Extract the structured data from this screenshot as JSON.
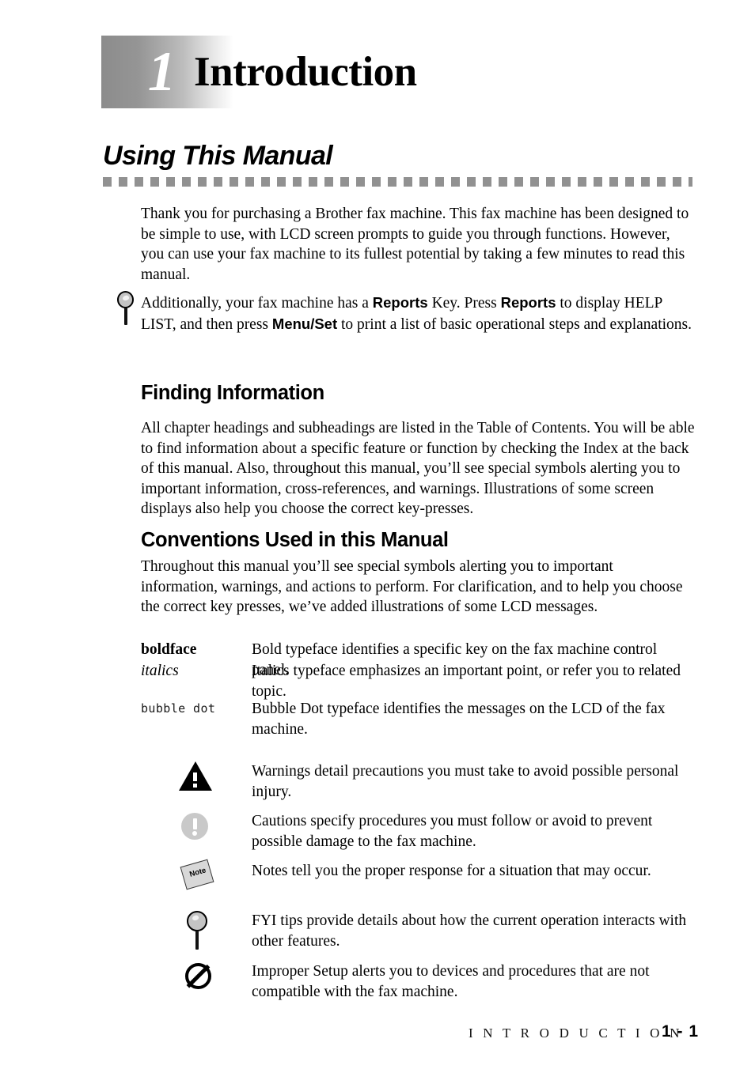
{
  "chapter": {
    "number": "1",
    "title": "Introduction"
  },
  "section": {
    "title": "Using This Manual"
  },
  "intro_paragraph": "Thank you for purchasing a Brother fax machine. This fax machine has been designed to be simple to use, with LCD screen prompts to guide you through functions. However, you can use your fax machine to its fullest potential by taking a few minutes to read this manual.",
  "fyi_note": {
    "icon": "magnifier-fyi-icon",
    "text_part_1": "Additionally, your fax machine has a ",
    "key_1": "Reports",
    "text_part_2": " Key. Press ",
    "key_2": "Reports",
    "text_part_3": " to display HELP LIST, and then press ",
    "key_3": "Menu/Set",
    "text_part_4": " to print a list of basic operational steps and explanations."
  },
  "finding_information": {
    "heading": "Finding Information",
    "body": "All chapter headings and subheadings are listed in the Table of Contents. You will be able to find information about a specific feature or function by checking the Index at the back of this manual. Also, throughout this manual, you’ll see special symbols alerting you to important information, cross-references, and warnings. Illustrations of some screen displays also help you choose the correct key-presses."
  },
  "conventions": {
    "heading": "Conventions Used in this Manual",
    "body": "Throughout this manual you’ll see special symbols alerting you to important information, warnings, and actions to perform. For clarification, and to help you choose the correct key presses, we’ve added illustrations of some LCD messages.",
    "typefaces": [
      {
        "term": "boldface",
        "style": "bold",
        "description": "Bold typeface identifies a specific key on the fax machine control panel."
      },
      {
        "term": "italics",
        "style": "italic",
        "description": "Italics typeface emphasizes an important point, or refer you to related topic."
      },
      {
        "term": "bubble dot",
        "style": "lcd",
        "description": "Bubble Dot typeface identifies the messages on the LCD of the fax machine."
      }
    ],
    "symbols": [
      {
        "icon": "warning-triangle-icon",
        "description": "Warnings detail precautions you must take to avoid possible personal injury."
      },
      {
        "icon": "caution-circle-icon",
        "description": "Cautions specify procedures you must follow or avoid to prevent possible damage to the fax machine."
      },
      {
        "icon": "note-sticky-icon",
        "label": "Note",
        "description": "Notes tell you the proper response for a situation that may occur."
      },
      {
        "icon": "magnifier-fyi-icon",
        "description": "FYI tips provide details about how the current operation interacts with other features."
      },
      {
        "icon": "prohibition-circle-icon",
        "description": "Improper Setup alerts you to devices and procedures that are not compatible with the fax machine."
      }
    ]
  },
  "footer": {
    "chapter_name": "I N T R O D U C T I O N",
    "page_number": "1 - 1"
  },
  "colors": {
    "gradient_start": "#8c8c8c",
    "dash_rule": "#919191",
    "caution_gray": "#c9c9c9",
    "note_gray": "#d8d8d8"
  }
}
